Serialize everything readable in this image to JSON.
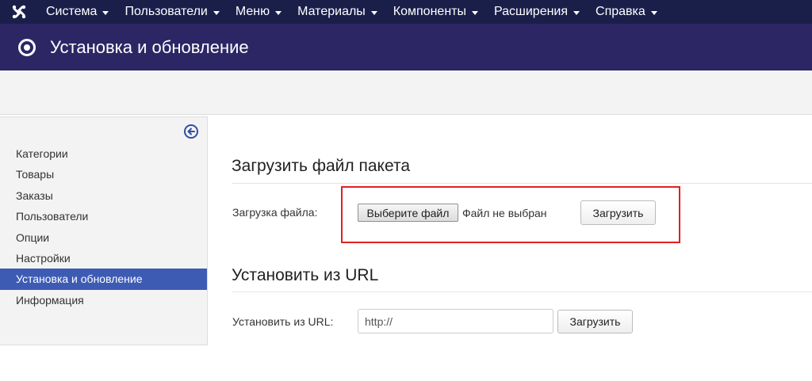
{
  "nav": {
    "logo_icon": "joomla-logo-icon",
    "items": [
      {
        "label": "Система"
      },
      {
        "label": "Пользователи"
      },
      {
        "label": "Меню"
      },
      {
        "label": "Материалы"
      },
      {
        "label": "Компоненты"
      },
      {
        "label": "Расширения"
      },
      {
        "label": "Справка"
      }
    ]
  },
  "header": {
    "icon": "target-icon",
    "title": "Установка и обновление"
  },
  "sidebar": {
    "collapse_icon": "arrow-left-circle-icon",
    "items": [
      {
        "label": "Категории",
        "active": false
      },
      {
        "label": "Товары",
        "active": false
      },
      {
        "label": "Заказы",
        "active": false
      },
      {
        "label": "Пользователи",
        "active": false
      },
      {
        "label": "Опции",
        "active": false
      },
      {
        "label": "Настройки",
        "active": false
      },
      {
        "label": "Установка и обновление",
        "active": true
      },
      {
        "label": "Информация",
        "active": false
      }
    ]
  },
  "upload": {
    "section_title": "Загрузить файл пакета",
    "field_label": "Загрузка файла:",
    "file_button": "Выберите файл",
    "file_status": "Файл не выбран",
    "submit_label": "Загрузить"
  },
  "url_install": {
    "section_title": "Установить из URL",
    "field_label": "Установить из URL:",
    "input_value": "http://",
    "submit_label": "Загрузить"
  },
  "colors": {
    "topnav": "#1a1f4a",
    "header": "#2d2665",
    "active_item": "#3e5bb4",
    "highlight": "#e02020"
  }
}
